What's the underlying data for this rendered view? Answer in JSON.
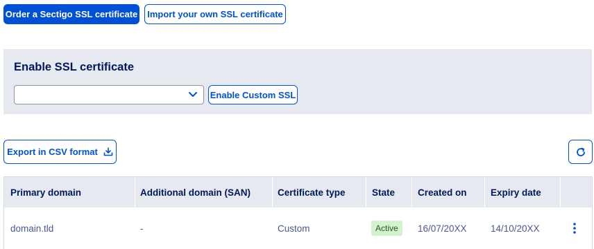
{
  "actions": {
    "order_label": "Order a Sectigo SSL certificate",
    "import_label": "Import your own SSL certificate"
  },
  "enable_panel": {
    "title": "Enable SSL certificate",
    "select_value": "",
    "enable_custom_label": "Enable Custom SSL"
  },
  "toolbar": {
    "export_label": "Export in CSV format",
    "export_icon": "download-icon",
    "refresh_icon": "refresh-icon"
  },
  "table": {
    "columns": [
      "Primary domain",
      "Additional domain (SAN)",
      "Certificate type",
      "State",
      "Created on",
      "Expiry date"
    ],
    "rows": [
      {
        "primary_domain": "domain.tld",
        "san": "-",
        "type": "Custom",
        "state": "Active",
        "created_on": "16/07/20XX",
        "expiry_date": "14/10/20XX",
        "menu_icon": "kebab-menu-icon"
      }
    ]
  },
  "colors": {
    "accent": "#0050d7",
    "heading": "#00185e",
    "panel_bg": "#e6e9ef",
    "badge_bg": "#d4f2cd"
  }
}
